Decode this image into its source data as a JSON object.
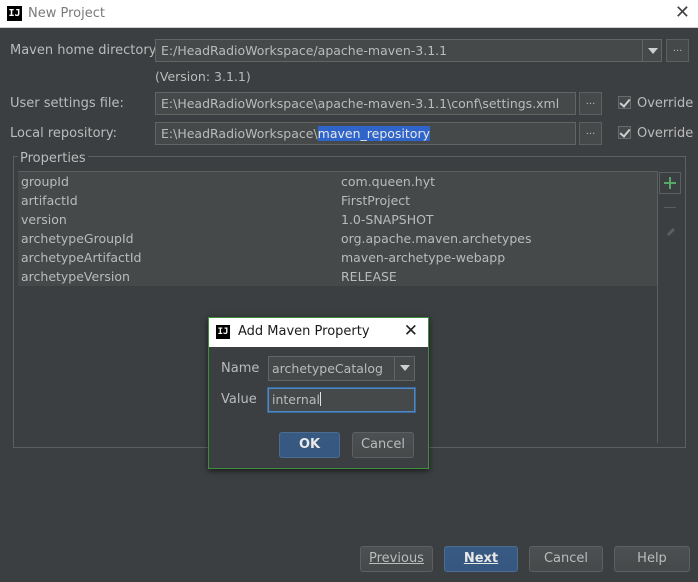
{
  "window": {
    "title": "New Project",
    "app_icon": "IJ"
  },
  "maven": {
    "home_label": "Maven home directory:",
    "home_value": "E:/HeadRadioWorkspace/apache-maven-3.1.1",
    "version_text": "(Version: 3.1.1)",
    "settings_label": "User settings file:",
    "settings_value": "E:\\HeadRadioWorkspace\\apache-maven-3.1.1\\conf\\settings.xml",
    "repo_label": "Local repository:",
    "repo_value_prefix": "E:\\HeadRadioWorkspace\\",
    "repo_value_selected": "maven_repository",
    "browse": "...",
    "override_label": "Override",
    "override_settings_checked": true,
    "override_repo_checked": true
  },
  "properties": {
    "legend": "Properties",
    "rows": [
      {
        "key": "groupId",
        "value": "com.queen.hyt"
      },
      {
        "key": "artifactId",
        "value": "FirstProject"
      },
      {
        "key": "version",
        "value": "1.0-SNAPSHOT"
      },
      {
        "key": "archetypeGroupId",
        "value": "org.apache.maven.archetypes"
      },
      {
        "key": "archetypeArtifactId",
        "value": "maven-archetype-webapp"
      },
      {
        "key": "archetypeVersion",
        "value": "RELEASE"
      }
    ]
  },
  "dialog": {
    "title": "Add Maven Property",
    "name_label": "Name",
    "name_value": "archetypeCatalog",
    "value_label": "Value",
    "value_value": "internal",
    "ok": "OK",
    "cancel": "Cancel"
  },
  "footer": {
    "previous": "Previous",
    "next": "Next",
    "cancel": "Cancel",
    "help": "Help"
  },
  "colors": {
    "background": "#3c3f41",
    "accent": "#365880",
    "selection": "#2f65ca",
    "add_icon": "#59a869"
  }
}
